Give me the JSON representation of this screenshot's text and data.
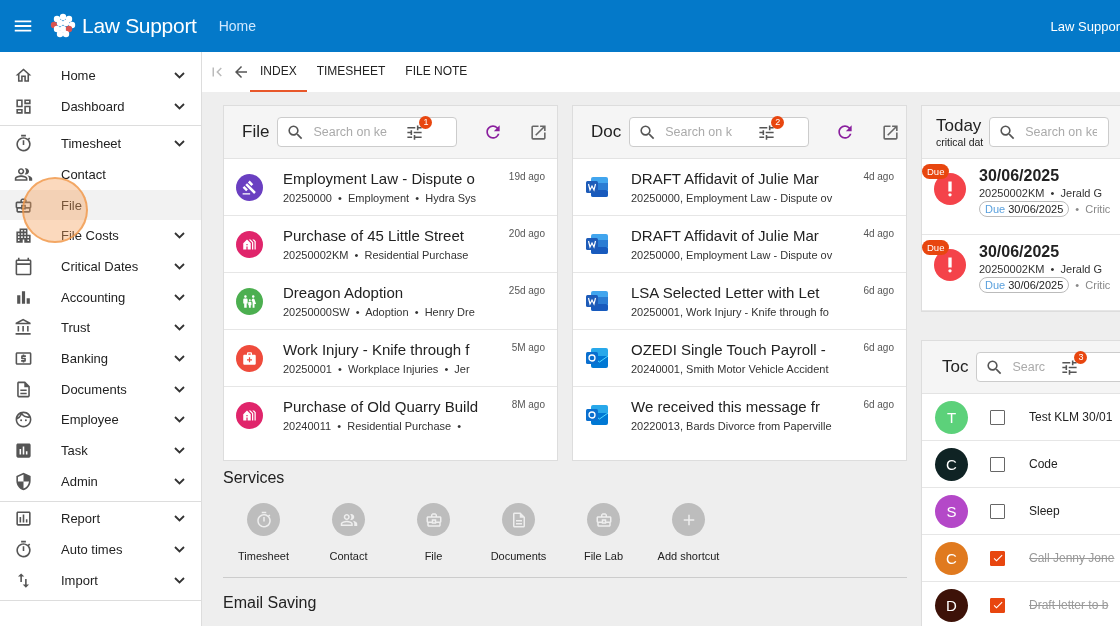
{
  "header": {
    "brand": "Law Support",
    "page": "Home",
    "user": "Law Suppor"
  },
  "sidebar": {
    "groups": [
      [
        {
          "label": "Home",
          "expandable": true,
          "selected": false
        },
        {
          "label": "Dashboard",
          "expandable": true,
          "selected": false
        }
      ],
      [
        {
          "label": "Timesheet",
          "expandable": true,
          "selected": false
        },
        {
          "label": "Contact",
          "expandable": false,
          "selected": false
        },
        {
          "label": "File",
          "expandable": false,
          "selected": true
        },
        {
          "label": "File Costs",
          "expandable": true,
          "selected": false
        },
        {
          "label": "Critical Dates",
          "expandable": true,
          "selected": false
        },
        {
          "label": "Accounting",
          "expandable": true,
          "selected": false
        },
        {
          "label": "Trust",
          "expandable": true,
          "selected": false
        },
        {
          "label": "Banking",
          "expandable": true,
          "selected": false
        },
        {
          "label": "Documents",
          "expandable": true,
          "selected": false
        },
        {
          "label": "Employee",
          "expandable": true,
          "selected": false
        },
        {
          "label": "Task",
          "expandable": true,
          "selected": false
        },
        {
          "label": "Admin",
          "expandable": true,
          "selected": false
        }
      ],
      [
        {
          "label": "Report",
          "expandable": true,
          "selected": false
        },
        {
          "label": "Auto times",
          "expandable": true,
          "selected": false
        },
        {
          "label": "Import",
          "expandable": true,
          "selected": false
        }
      ]
    ]
  },
  "tabs": [
    {
      "label": "INDEX",
      "selected": true
    },
    {
      "label": "TIMESHEET",
      "selected": false
    },
    {
      "label": "FILE NOTE",
      "selected": false
    }
  ],
  "file_card": {
    "title": "File",
    "search": {
      "placeholder": "Search on ke"
    },
    "filter_count": "1",
    "rows": [
      {
        "title": "Employment Law - Dispute o",
        "meta": "20250000  •  Employment  •  Hydra Sys",
        "time": "19d ago",
        "color": "#6a3fc1"
      },
      {
        "title": "Purchase of 45 Little Street",
        "meta": "20250002KM  •  Residential Purchase",
        "time": "20d ago",
        "color": "#e0256b"
      },
      {
        "title": "Dreagon Adoption",
        "meta": "20250000SW  •  Adoption  •  Henry Dre",
        "time": "25d ago",
        "color": "#4caf50"
      },
      {
        "title": "Work Injury - Knife through f",
        "meta": "20250001  •  Workplace Injuries  •  Jer",
        "time": "5M ago",
        "color": "#ef4b3c"
      },
      {
        "title": "Purchase of Old Quarry Build",
        "meta": "20240011  •  Residential Purchase  •",
        "time": "8M ago",
        "color": "#e0256b"
      }
    ]
  },
  "doc_card": {
    "title": "Doc",
    "search": {
      "placeholder": "Search on k"
    },
    "filter_count": "2",
    "rows": [
      {
        "kind": "word",
        "title": "DRAFT Affidavit of Julie Mar",
        "meta": "20250000, Employment Law - Dispute ov",
        "time": "4d ago"
      },
      {
        "kind": "word",
        "title": "DRAFT Affidavit of Julie Mar",
        "meta": "20250000, Employment Law - Dispute ov",
        "time": "4d ago"
      },
      {
        "kind": "word",
        "title": "LSA Selected Letter with Let",
        "meta": "20250001, Work Injury - Knife through fo",
        "time": "6d ago"
      },
      {
        "kind": "outlook",
        "title": "OZEDI Single Touch Payroll -",
        "meta": "20240001, Smith Motor Vehicle Accident",
        "time": "6d ago"
      },
      {
        "kind": "outlook",
        "title": "We received this message fr",
        "meta": "20220013, Bards Divorce from Paperville",
        "time": "6d ago"
      }
    ]
  },
  "today_card": {
    "title": "Today",
    "subtitle": "critical dat",
    "search": {
      "placeholder": "Search on ke"
    },
    "rows": [
      {
        "badge": "Due",
        "date": "30/06/2025",
        "meta": "20250002KM  •  Jerald G",
        "chip_label": "Due",
        "chip_date": "30/06/2025",
        "extra": "•  Critic"
      },
      {
        "badge": "Due",
        "date": "30/06/2025",
        "meta": "20250002KM  •  Jerald G",
        "chip_label": "Due",
        "chip_date": "30/06/2025",
        "extra": "•  Critic"
      }
    ]
  },
  "todo_card": {
    "title": "Toc",
    "search": {
      "placeholder": "Searc"
    },
    "filter_count": "3",
    "rows": [
      {
        "initial": "T",
        "color": "#5cd17a",
        "checked": false,
        "text": "Test KLM 30/01"
      },
      {
        "initial": "C",
        "color": "#0f2324",
        "checked": false,
        "text": "Code"
      },
      {
        "initial": "S",
        "color": "#b448c8",
        "checked": false,
        "text": "Sleep"
      },
      {
        "initial": "C",
        "color": "#e07a1f",
        "checked": true,
        "text": "Call Jenny Jone"
      },
      {
        "initial": "D",
        "color": "#3d1208",
        "checked": true,
        "text": "Draft letter to b"
      }
    ]
  },
  "services": {
    "title": "Services",
    "shortcuts": [
      "Timesheet",
      "Contact",
      "File",
      "Documents",
      "File Lab",
      "Add shortcut"
    ]
  },
  "email_saving": {
    "title": "Email Saving"
  }
}
